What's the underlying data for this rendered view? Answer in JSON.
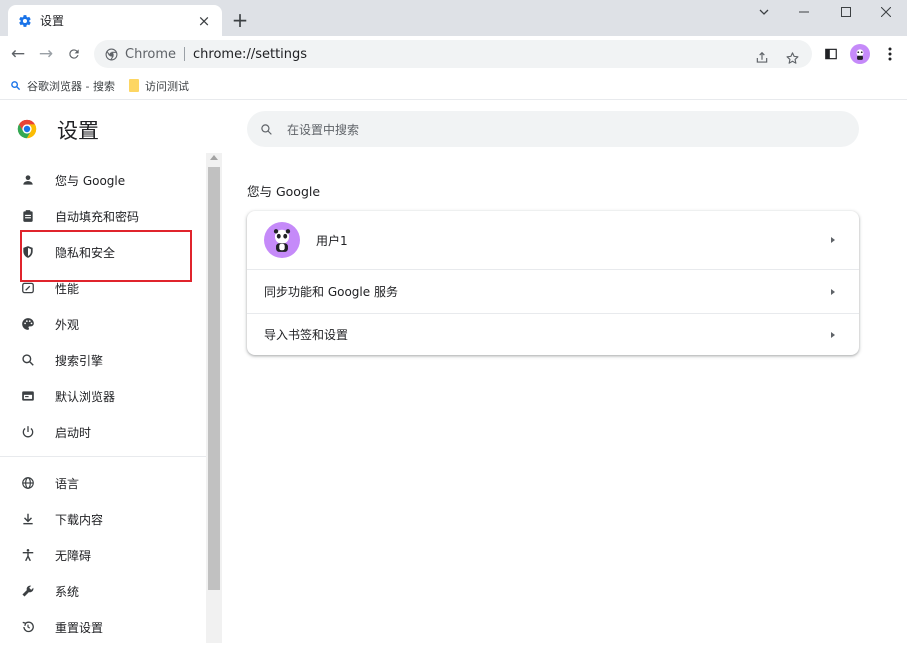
{
  "tab": {
    "title": "设置",
    "close": "×",
    "new_tab": "+"
  },
  "window": {
    "minimize": "—",
    "maximize": "☐",
    "close": "✕",
    "tab_search": "⌄"
  },
  "toolbar": {
    "back": "←",
    "forward": "→",
    "reload": "C",
    "url_prefix": "Chrome",
    "url": "chrome://settings"
  },
  "bookmarks": [
    {
      "label": "谷歌浏览器 - 搜索",
      "icon": "search-icon"
    },
    {
      "label": "访问测试",
      "icon": "folder-icon"
    }
  ],
  "settings": {
    "title": "设置",
    "search_placeholder": "在设置中搜索"
  },
  "sidebar": {
    "items": [
      {
        "label": "您与 Google",
        "icon": "person-icon"
      },
      {
        "label": "自动填充和密码",
        "icon": "clipboard-icon"
      },
      {
        "label": "隐私和安全",
        "icon": "shield-icon"
      },
      {
        "label": "性能",
        "icon": "speedometer-icon"
      },
      {
        "label": "外观",
        "icon": "palette-icon"
      },
      {
        "label": "搜索引擎",
        "icon": "search-icon"
      },
      {
        "label": "默认浏览器",
        "icon": "browser-icon"
      },
      {
        "label": "启动时",
        "icon": "power-icon"
      },
      {
        "label": "语言",
        "icon": "globe-icon"
      },
      {
        "label": "下载内容",
        "icon": "download-icon"
      },
      {
        "label": "无障碍",
        "icon": "accessibility-icon"
      },
      {
        "label": "系统",
        "icon": "wrench-icon"
      },
      {
        "label": "重置设置",
        "icon": "history-icon"
      }
    ]
  },
  "main": {
    "section_title": "您与 Google",
    "rows": [
      {
        "label": "用户1"
      },
      {
        "label": "同步功能和 Google 服务"
      },
      {
        "label": "导入书签和设置"
      }
    ]
  },
  "colors": {
    "tabstrip": "#dee1e6",
    "accent_blue": "#1a73e8",
    "avatar": "#c58af9",
    "highlight": "#e0242c"
  }
}
